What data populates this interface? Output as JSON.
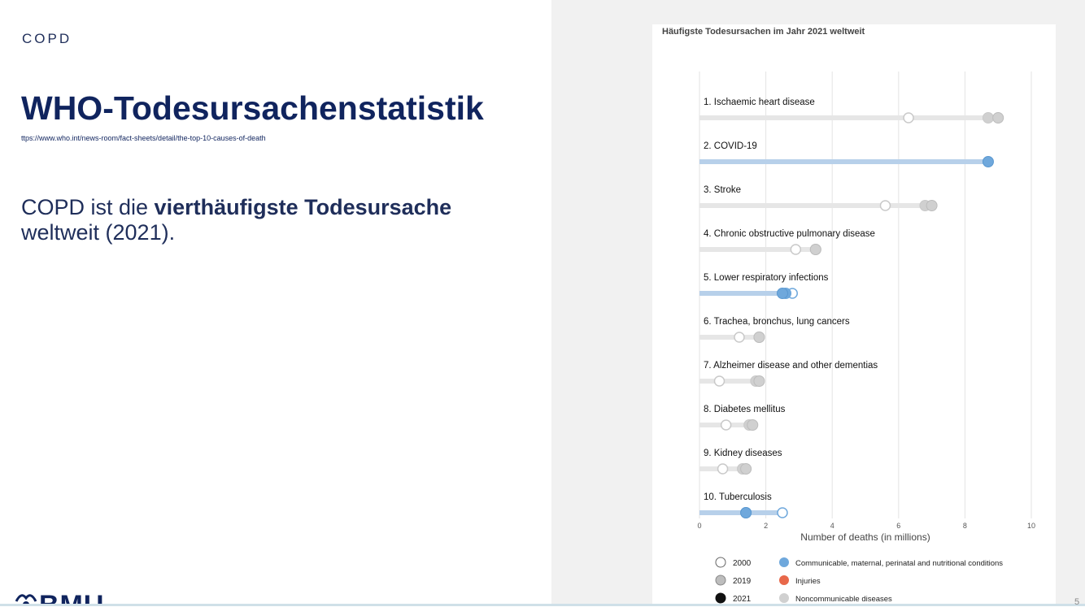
{
  "slide": {
    "section": "COPD",
    "title": "WHO-Todesursachenstatistik",
    "source": "ttps://www.who.int/news-room/fact-sheets/detail/the-top-10-causes-of-death",
    "body_pre": "COPD ist die ",
    "body_bold": "vierthäufigste Todesursache",
    "body_post": "weltweit (2021).",
    "logo_text": "BMU",
    "page_number": "5"
  },
  "colors": {
    "communicable": "#6fa8dc",
    "communicable_bar": "#b7d0ea",
    "injuries": "#e8684a",
    "noncommunicable": "#d0d0d0",
    "noncommunicable_bar": "#e6e6e6",
    "dark_blue": "#10245e"
  },
  "chart_data": {
    "type": "scatter",
    "title": "Häufigste Todesursachen im Jahr 2021 weltweit",
    "xlabel": "Number of deaths (in millions)",
    "xlim": [
      0,
      10
    ],
    "xticks": [
      "0",
      "2",
      "4",
      "6",
      "8",
      "10"
    ],
    "grid": true,
    "legend_position": "bottom",
    "legend": {
      "years": [
        "2000",
        "2019",
        "2021"
      ],
      "groups": [
        "Communicable, maternal, perinatal and nutritional conditions",
        "Injuries",
        "Noncommunicable diseases"
      ]
    },
    "causes": [
      {
        "label": "1. Ischaemic heart disease",
        "group": "noncommunicable",
        "y2000": 6.3,
        "y2019": 8.7,
        "y2021": 9.0
      },
      {
        "label": "2. COVID-19",
        "group": "communicable",
        "y2000": null,
        "y2019": null,
        "y2021": 8.7
      },
      {
        "label": "3. Stroke",
        "group": "noncommunicable",
        "y2000": 5.6,
        "y2019": 6.8,
        "y2021": 7.0
      },
      {
        "label": "4. Chronic obstructive pulmonary disease",
        "group": "noncommunicable",
        "y2000": 2.9,
        "y2019": 3.5,
        "y2021": 3.5
      },
      {
        "label": "5. Lower respiratory infections",
        "group": "communicable",
        "y2000": 2.8,
        "y2019": 2.6,
        "y2021": 2.5
      },
      {
        "label": "6. Trachea, bronchus, lung cancers",
        "group": "noncommunicable",
        "y2000": 1.2,
        "y2019": 1.8,
        "y2021": 1.8
      },
      {
        "label": "7. Alzheimer disease and other dementias",
        "group": "noncommunicable",
        "y2000": 0.6,
        "y2019": 1.7,
        "y2021": 1.8
      },
      {
        "label": "8. Diabetes mellitus",
        "group": "noncommunicable",
        "y2000": 0.8,
        "y2019": 1.5,
        "y2021": 1.6
      },
      {
        "label": "9. Kidney diseases",
        "group": "noncommunicable",
        "y2000": 0.7,
        "y2019": 1.3,
        "y2021": 1.4
      },
      {
        "label": "10. Tuberculosis",
        "group": "communicable",
        "y2000": 2.5,
        "y2019": 1.4,
        "y2021": 1.4
      }
    ]
  }
}
